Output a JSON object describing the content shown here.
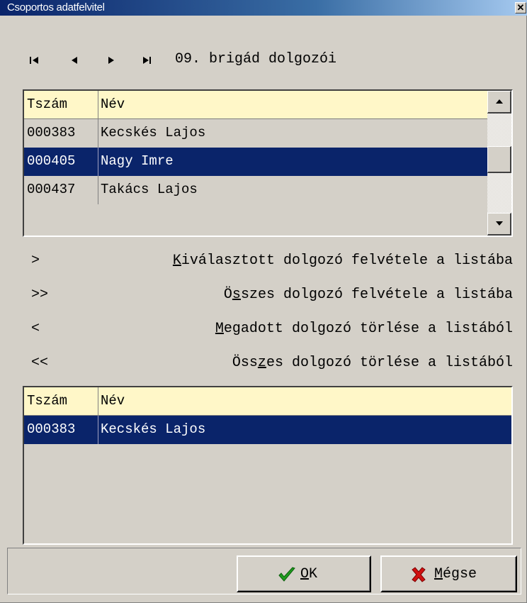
{
  "window": {
    "title": "Csoportos adatfelvitel",
    "close_glyph": "✕"
  },
  "nav": {
    "first_icon": "first-record-icon",
    "prev_icon": "previous-record-icon",
    "next_icon": "next-record-icon",
    "last_icon": "last-record-icon",
    "title": "09. brigád dolgozói"
  },
  "top_list": {
    "columns": [
      "Tszám",
      "Név"
    ],
    "rows": [
      {
        "tszam": "000383",
        "nev": "Kecskés Lajos",
        "selected": false
      },
      {
        "tszam": "000405",
        "nev": "Nagy Imre",
        "selected": true
      },
      {
        "tszam": "000437",
        "nev": "Takács Lajos",
        "selected": false
      }
    ]
  },
  "actions": [
    {
      "symbol": ">",
      "pre": "",
      "key": "K",
      "post": "iválasztott dolgozó felvétele a listába"
    },
    {
      "symbol": ">>",
      "pre": "Ö",
      "key": "s",
      "post": "szes dolgozó felvétele a listába"
    },
    {
      "symbol": "<",
      "pre": "",
      "key": "M",
      "post": "egadott dolgozó törlése a listából"
    },
    {
      "symbol": "<<",
      "pre": "Öss",
      "key": "z",
      "post": "es dolgozó törlése a listából"
    }
  ],
  "bottom_list": {
    "columns": [
      "Tszám",
      "Név"
    ],
    "rows": [
      {
        "tszam": "000383",
        "nev": "Kecskés Lajos",
        "selected": true
      }
    ]
  },
  "buttons": {
    "ok": {
      "key": "O",
      "rest": "K",
      "icon": "checkmark-icon",
      "icon_color": "#1e9c1e"
    },
    "cancel": {
      "key": "M",
      "rest": "égse",
      "icon": "x-cross-icon",
      "icon_color": "#d01010"
    }
  },
  "colors": {
    "header_bg": "#fff7c8",
    "selection_bg": "#0a246a",
    "face": "#d4d0c8"
  }
}
